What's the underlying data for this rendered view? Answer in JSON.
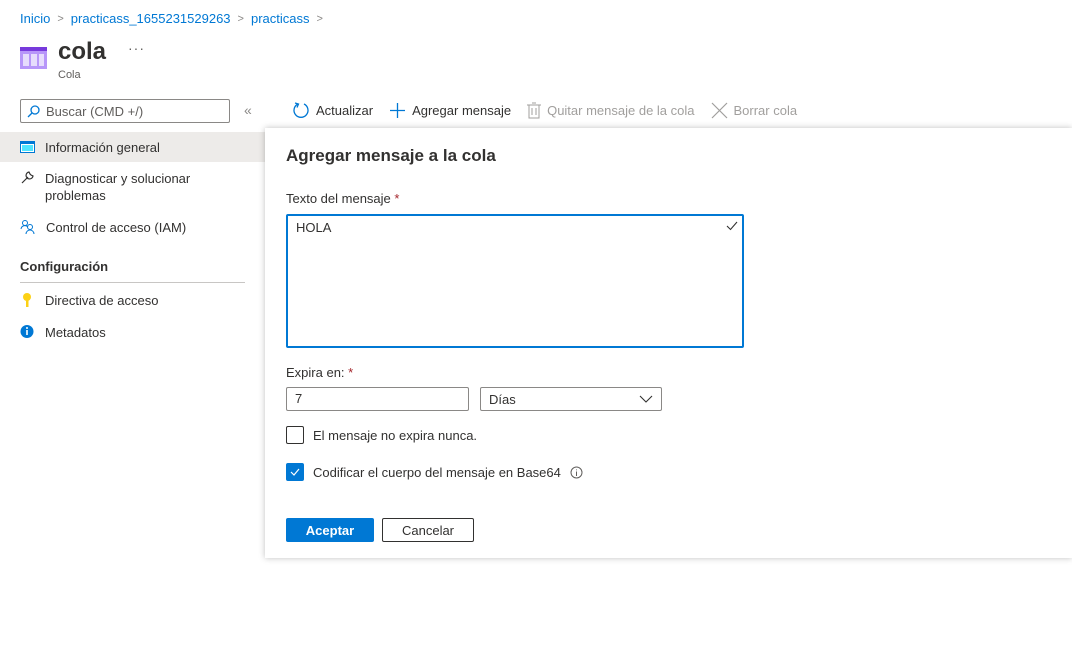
{
  "breadcrumb": [
    "Inicio",
    "practicass_1655231529263",
    "practicass"
  ],
  "header": {
    "title": "cola",
    "subtitle": "Cola",
    "more": "···"
  },
  "search": {
    "placeholder": "Buscar (CMD +/)"
  },
  "collapse": "«",
  "sidebar": {
    "items": [
      {
        "label": "Información general",
        "icon": "overview-icon",
        "active": true
      },
      {
        "label": "Diagnosticar y solucionar problemas",
        "icon": "wrench-icon"
      },
      {
        "label": "Control de acceso (IAM)",
        "icon": "people-icon"
      }
    ],
    "section": "Configuración",
    "config_items": [
      {
        "label": "Directiva de acceso",
        "icon": "key-icon"
      },
      {
        "label": "Metadatos",
        "icon": "info-icon"
      }
    ]
  },
  "toolbar": {
    "refresh": "Actualizar",
    "add": "Agregar mensaje",
    "dequeue": "Quitar mensaje de la cola",
    "clear": "Borrar cola"
  },
  "panel": {
    "title": "Agregar mensaje a la cola",
    "message_label": "Texto del mensaje",
    "message_value": "HOLA",
    "required": "*",
    "expires_label": "Expira en:",
    "expires_value": "7",
    "unit": "Días",
    "never_expires": "El mensaje no expira nunca.",
    "never_expires_checked": false,
    "base64": "Codificar el cuerpo del mensaje en Base64",
    "base64_checked": true,
    "ok": "Aceptar",
    "cancel": "Cancelar"
  },
  "colors": {
    "accent": "#0078d4",
    "icon_purple": "#8661c5",
    "required": "#a4262c"
  }
}
